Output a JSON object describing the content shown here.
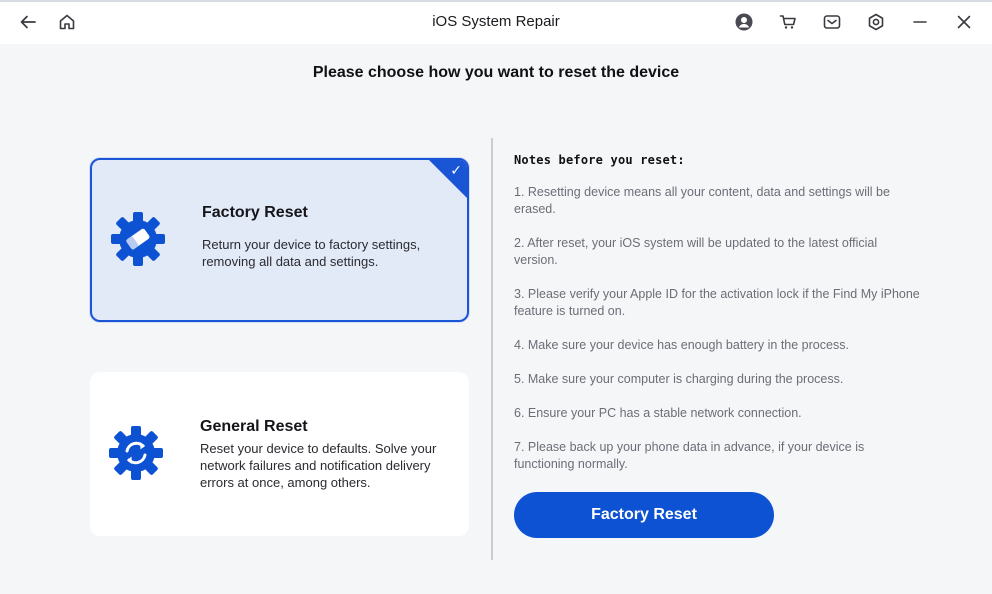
{
  "window": {
    "title": "iOS System Repair"
  },
  "content": {
    "heading": "Please choose how you want to reset the device"
  },
  "options": [
    {
      "title": "Factory Reset",
      "description": "Return your device to factory settings, removing all data and settings.",
      "selected": true,
      "icon": "gear-eraser-icon"
    },
    {
      "title": "General Reset",
      "description": "Reset your device to defaults. Solve your network failures and notification delivery errors at once, among others.",
      "selected": false,
      "icon": "gear-refresh-icon"
    }
  ],
  "notes": {
    "title": "Notes before you reset:",
    "items": [
      "1. Resetting device means all your content, data and settings will be erased.",
      "2. After reset, your iOS system will be updated to the latest official version.",
      "3. Please verify your Apple ID for the activation lock if the Find My iPhone feature is turned on.",
      "4. Make sure your device has enough battery in the process.",
      "5. Make sure your computer is charging during the process.",
      "6. Ensure your PC has a stable network connection.",
      "7. Please back up your phone data in advance, if your device is functioning normally."
    ]
  },
  "action": {
    "label": "Factory Reset"
  },
  "colors": {
    "accent": "#0c52d2",
    "selected_bg": "#e3eaf7",
    "muted_text": "#6b6e76"
  }
}
